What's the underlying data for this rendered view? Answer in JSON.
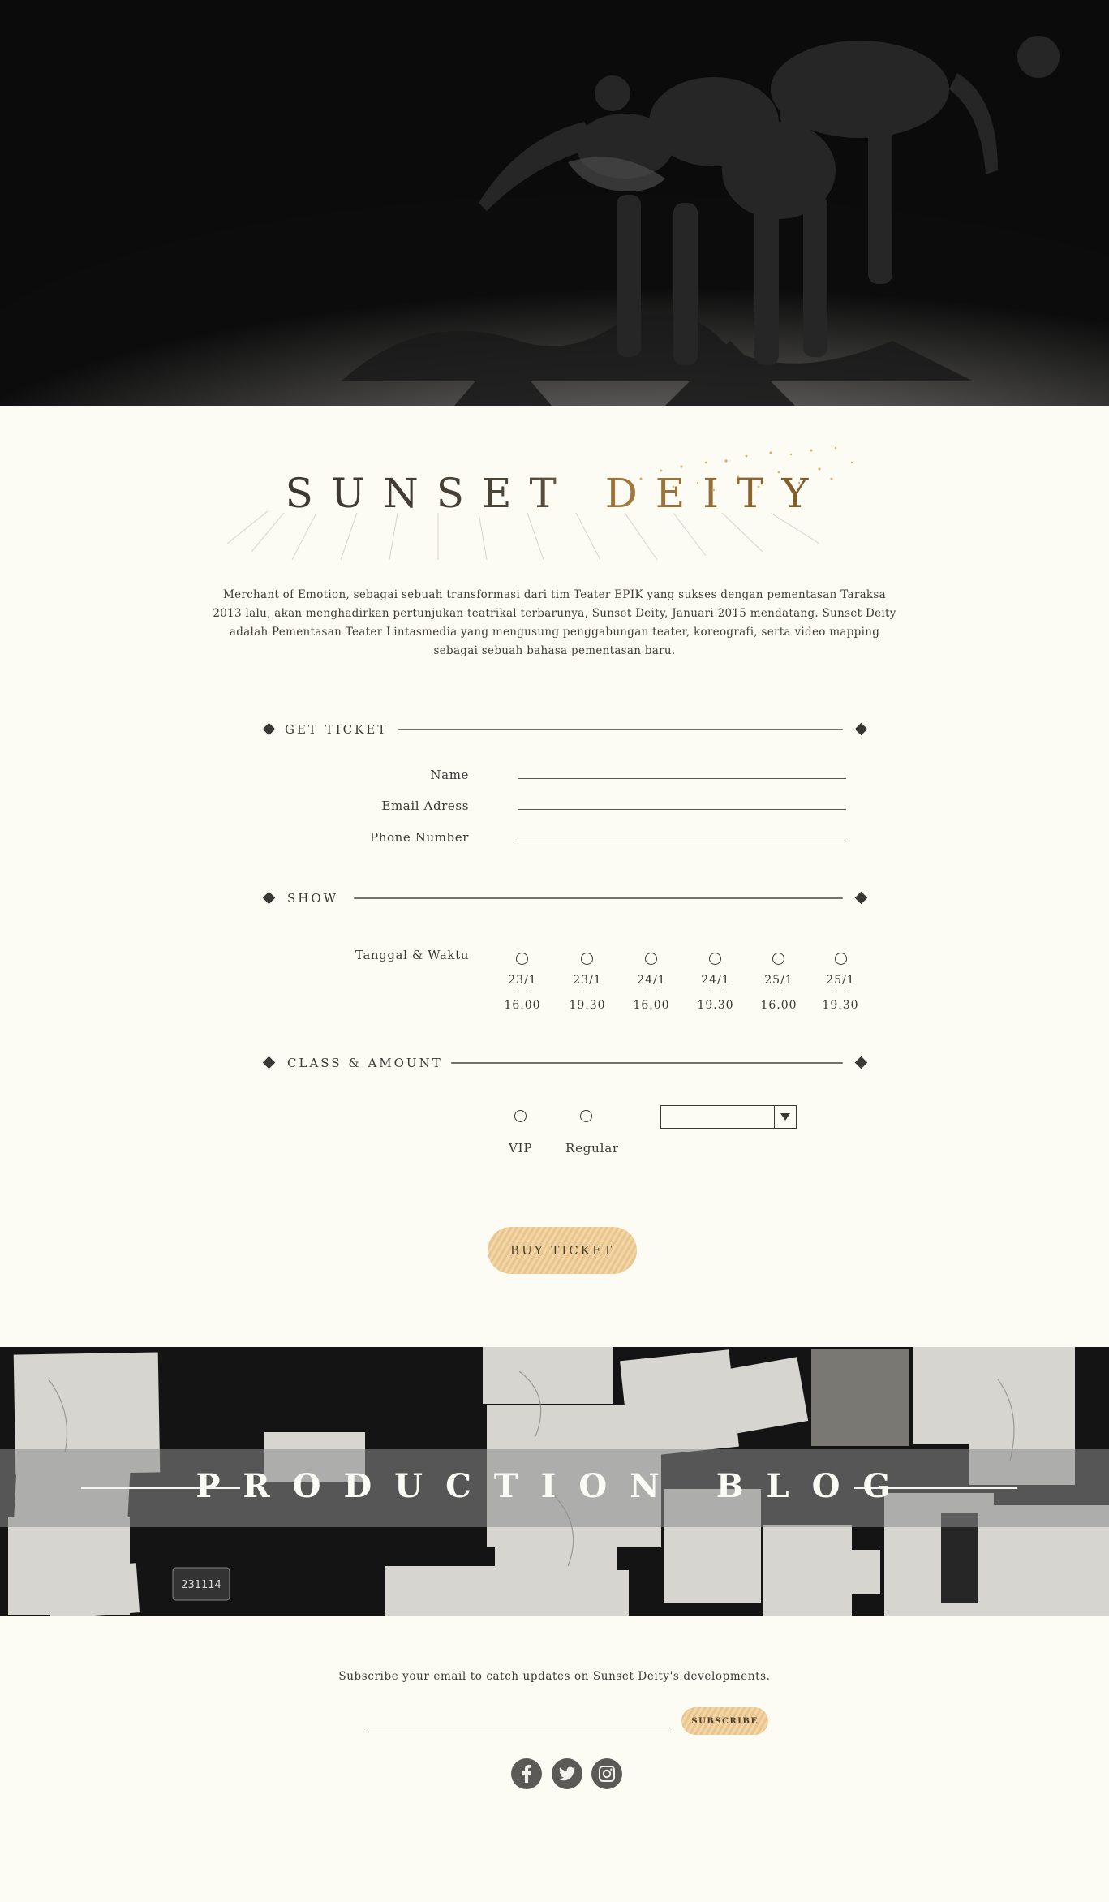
{
  "brand": {
    "logo_text": "SUNSET DEITY"
  },
  "intro": {
    "text": "Merchant of Emotion, sebagai sebuah transformasi dari tim Teater EPIK yang sukses dengan pementasan Taraksa 2013 lalu, akan menghadirkan pertunjukan teatrikal terbarunya, Sunset Deity, Januari 2015 mendatang. Sunset Deity adalah Pementasan Teater Lintasmedia yang mengusung penggabungan teater, koreografi, serta video mapping sebagai sebuah bahasa pementasan baru."
  },
  "ticket": {
    "heading": "GET TICKET",
    "fields": [
      {
        "label": "Name",
        "value": ""
      },
      {
        "label": "Email Adress",
        "value": ""
      },
      {
        "label": "Phone Number",
        "value": ""
      }
    ]
  },
  "show": {
    "heading": "SHOW",
    "label": "Tanggal & Waktu",
    "slots": [
      {
        "date": "23/1",
        "time": "16.00"
      },
      {
        "date": "23/1",
        "time": "19.30"
      },
      {
        "date": "24/1",
        "time": "16.00"
      },
      {
        "date": "24/1",
        "time": "19.30"
      },
      {
        "date": "25/1",
        "time": "16.00"
      },
      {
        "date": "25/1",
        "time": "19.30"
      }
    ]
  },
  "class_amount": {
    "heading": "CLASS & AMOUNT",
    "classes": [
      "VIP",
      "Regular"
    ],
    "amount_selected": ""
  },
  "buy_label": "BUY TICKET",
  "blog": {
    "title": "PRODUCTION BLOG",
    "sticker": "231114"
  },
  "subscribe": {
    "text": "Subscribe your email to catch updates on Sunset Deity's developments.",
    "button": "SUBSCRIBE",
    "email_value": ""
  },
  "social": [
    "facebook-icon",
    "twitter-icon",
    "instagram-icon"
  ],
  "colors": {
    "background": "#fcfbf4",
    "accent_gold": "#e9c48c",
    "text": "#3a3835"
  }
}
